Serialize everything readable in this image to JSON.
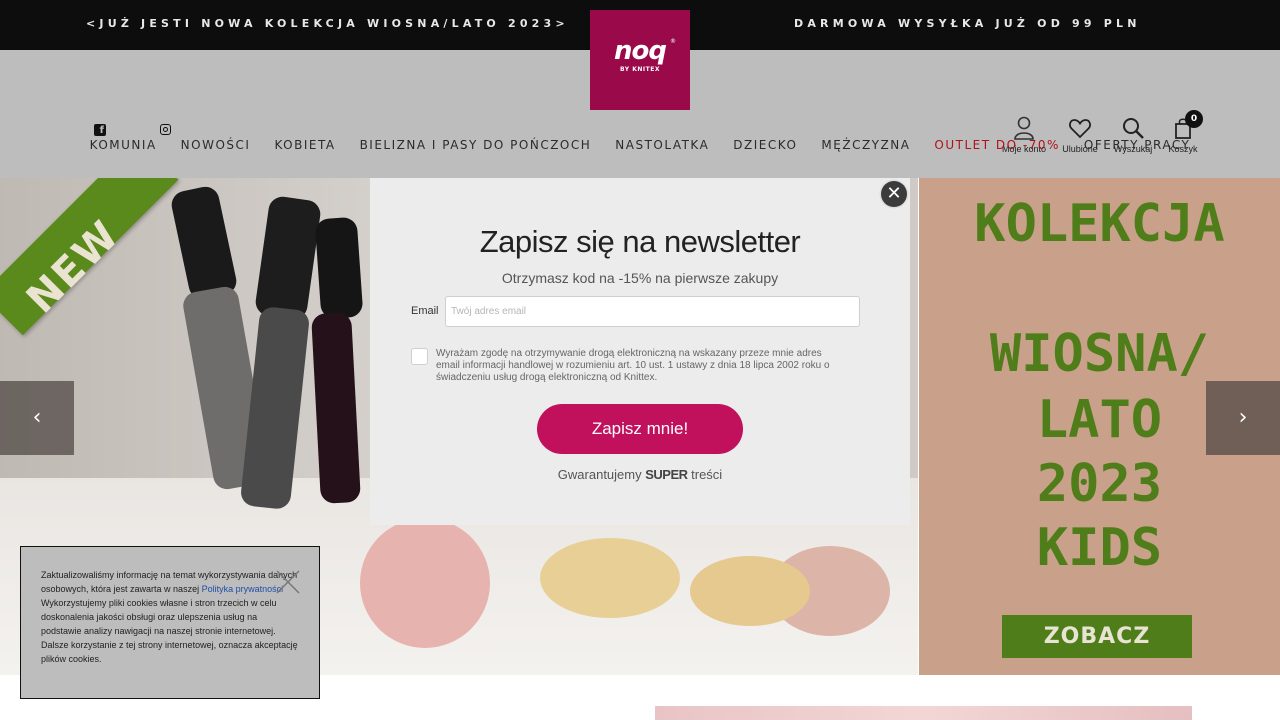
{
  "topbar": {
    "promo_left": "<JUŻ JESTI NOWA KOLEKCJA WIOSNA/LATO 2023>",
    "promo_right": "DARMOWA WYSYŁKA JUŻ OD 99 PLN"
  },
  "logo": {
    "word": "noq",
    "sub": "BY KNITEX",
    "reg": "®"
  },
  "header": {
    "account_label": "Moje konto",
    "favorites_label": "Ulubione",
    "search_label": "Wyszukaj",
    "cart_label": "Koszyk",
    "cart_count": "0"
  },
  "nav": {
    "items": [
      "KOMUNIA",
      "NOWOŚCI",
      "KOBIETA",
      "BIELIZNA I PASY DO POŃCZOCH",
      "NASTOLATKA",
      "DZIECKO",
      "MĘŻCZYZNA",
      "OUTLET DO -70%",
      "OFERTY PRACY"
    ]
  },
  "hero": {
    "ribbon_text": "NEW",
    "prev_arrow": "‹",
    "next_arrow": "›"
  },
  "promo_card": {
    "line1": "KOLEKCJA",
    "line2": "WIOSNA/",
    "line3": "LATO",
    "line4": "2023",
    "line5": "KIDS",
    "cta": "ZOBACZ"
  },
  "modal": {
    "close": "✕",
    "title": "Zapisz się na newsletter",
    "subtitle": "Otrzymasz kod na -15% na pierwsze zakupy",
    "email_label": "Email",
    "email_placeholder": "Twój adres email",
    "consent": "Wyrażam zgodę na otrzymywanie drogą elektroniczną na wskazany przeze mnie adres email informacji handlowej w rozumieniu art. 10 ust. 1 ustawy z dnia 18 lipca 2002 roku o świadczeniu usług drogą elektroniczną od Knittex.",
    "subscribe": "Zapisz mnie!",
    "guarantee_prefix": "Gwarantujemy ",
    "guarantee_bold": "SUPER",
    "guarantee_suffix": " treści"
  },
  "cookie": {
    "text1": "Zaktualizowaliśmy informację na temat wykorzystywania danych osobowych, która jest zawarta w naszej ",
    "link": "Polityka prywatności",
    "text2": "Wykorzystujemy pliki cookies własne i stron trzecich w celu doskonalenia jakości obsługi oraz ulepszenia usług na podstawie analizy nawigacji na naszej stronie internetowej. Dalsze korzystanie z tej strony internetowej, oznacza akceptację plików cookies."
  },
  "colors": {
    "brand": "#9a0a4b",
    "subscribe_button": "#c1105c",
    "outlet": "#b0121a",
    "promo_green": "#4f7d1a",
    "promo_bg": "#c9a18b"
  }
}
